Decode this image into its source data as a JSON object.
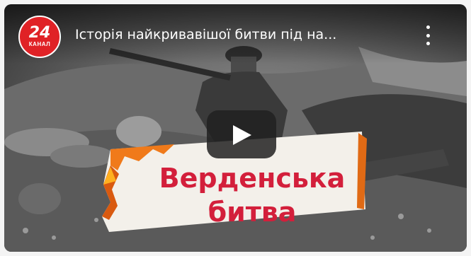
{
  "channel": {
    "logo_number": "24",
    "logo_label": "КАНАЛ",
    "brand_color": "#e02226"
  },
  "video": {
    "title": "Історія найкривавішої битви під на...",
    "thumbnail_text_line1": "Верденська",
    "thumbnail_text_line2": "битва",
    "thumbnail_text_color": "#d31f3b"
  },
  "controls": {
    "play_icon": "play-icon",
    "menu_icon": "more-vert-icon"
  }
}
